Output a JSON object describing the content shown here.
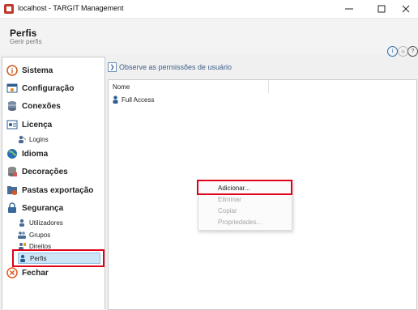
{
  "window": {
    "title": "localhost - TARGIT Management"
  },
  "header": {
    "title": "Perfis",
    "subtitle": "Gerir perfis"
  },
  "sidebar": {
    "items": [
      {
        "label": "Sistema",
        "icon": "info-icon"
      },
      {
        "label": "Configuração",
        "icon": "settings-icon"
      },
      {
        "label": "Conexões",
        "icon": "database-icon"
      },
      {
        "label": "Licença",
        "icon": "license-icon"
      },
      {
        "label": "Logins",
        "icon": "logins-icon",
        "sub": true
      },
      {
        "label": "Idioma",
        "icon": "globe-icon"
      },
      {
        "label": "Decorações",
        "icon": "decorations-icon"
      },
      {
        "label": "Pastas exportação",
        "icon": "export-folders-icon"
      },
      {
        "label": "Segurança",
        "icon": "lock-icon"
      },
      {
        "label": "Utilizadores",
        "icon": "users-icon",
        "sub": true
      },
      {
        "label": "Grupos",
        "icon": "groups-icon",
        "sub": true
      },
      {
        "label": "Direitos",
        "icon": "rights-icon",
        "sub": true
      },
      {
        "label": "Perfis",
        "icon": "profile-icon",
        "sub": true,
        "selected": true
      },
      {
        "label": "Fechar",
        "icon": "close-circle-icon"
      }
    ]
  },
  "main": {
    "breadcrumb": "Observe as permissões de usuário",
    "list": {
      "column": "Nome",
      "rows": [
        "Full Access"
      ]
    }
  },
  "context_menu": {
    "items": [
      {
        "label": "Adicionar...",
        "enabled": true
      },
      {
        "label": "Eliminar",
        "enabled": false
      },
      {
        "label": "Copiar",
        "enabled": false
      },
      {
        "label": "Propriedades...",
        "enabled": false
      }
    ]
  },
  "colors": {
    "highlight_red": "#e0001b",
    "selection_blue": "#cce6f7",
    "accent_blue": "#1f6fb8"
  }
}
